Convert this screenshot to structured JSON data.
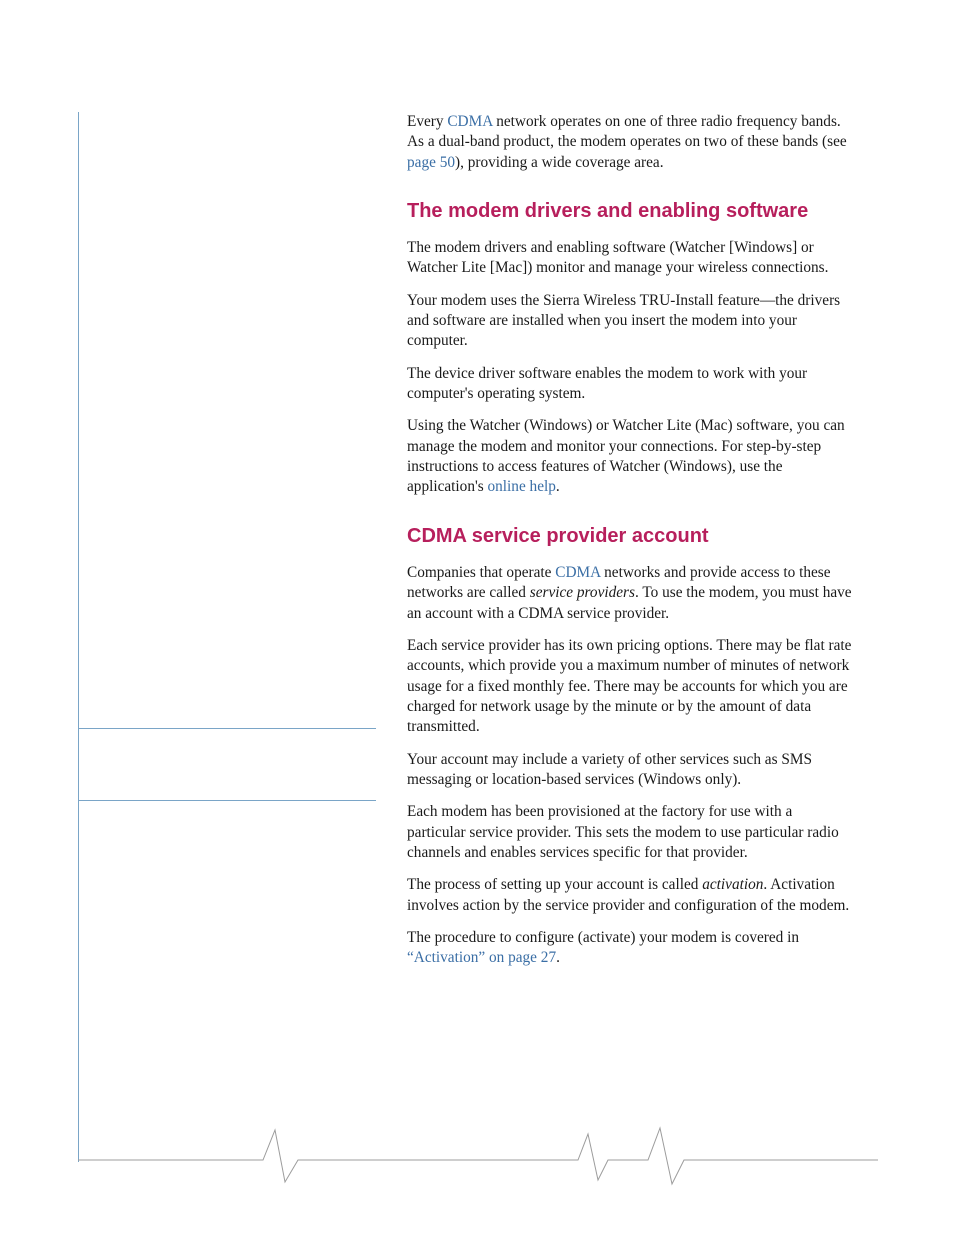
{
  "intro": {
    "p1_a": "Every ",
    "p1_link1": "CDMA",
    "p1_b": " network operates on one of three radio frequency bands. As a dual-band product, the modem operates on two of these bands (see ",
    "p1_link2": "page 50",
    "p1_c": "), providing a wide coverage area."
  },
  "section1": {
    "heading": "The modem drivers and enabling software",
    "p1": "The modem drivers and enabling software (Watcher [Windows] or Watcher Lite [Mac]) monitor and manage your wireless connections.",
    "p2": "Your modem uses the Sierra Wireless TRU-Install feature—the drivers and software are installed when you insert the modem into your computer.",
    "p3": "The device driver software enables the modem to work with your computer's operating system.",
    "p4_a": "Using the Watcher (Windows) or Watcher Lite (Mac) software, you can manage the modem and monitor your connections. For step-by-step instructions to access features of Watcher (Windows), use the application's ",
    "p4_link": "online help",
    "p4_b": "."
  },
  "section2": {
    "heading": "CDMA service provider account",
    "p1_a": "Companies that operate ",
    "p1_link": "CDMA",
    "p1_b": " networks and provide access to these networks are called ",
    "p1_em": "service providers",
    "p1_c": ". To use the modem, you must have an account with a CDMA service provider.",
    "p2": "Each service provider has its own pricing options. There may be flat rate accounts, which provide you a maximum number of minutes of network usage for a fixed monthly fee. There may be accounts for which you are charged for network usage by the minute or by the amount of data transmitted.",
    "p3": "Your account may include a variety of other services such as SMS messaging or location-based services (Windows only).",
    "p4": "Each modem has been provisioned at the factory for use with a particular service provider. This sets the modem to use particular radio channels and enables services specific for that provider.",
    "p5_a": "The process of setting up your account is called ",
    "p5_em": "activation",
    "p5_b": ". Activation involves action by the service provider and configu­ration of the modem.",
    "p6_a": "The procedure to configure (activate) your modem is covered in ",
    "p6_link": "“Activation” on page 27",
    "p6_b": "."
  }
}
